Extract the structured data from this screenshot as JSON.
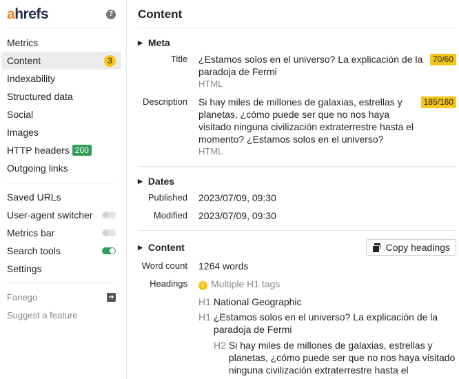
{
  "sidebar": {
    "logo": {
      "a": "a",
      "rest": "hrefs"
    },
    "help": "?",
    "items": [
      {
        "label": "Metrics"
      },
      {
        "label": "Content",
        "badge": "3"
      },
      {
        "label": "Indexability"
      },
      {
        "label": "Structured data"
      },
      {
        "label": "Social"
      },
      {
        "label": "Images"
      },
      {
        "label": "HTTP headers",
        "badge": "200"
      },
      {
        "label": "Outgoing links"
      }
    ],
    "tools": [
      {
        "label": "Saved URLs"
      },
      {
        "label": "User-agent switcher",
        "toggle": false
      },
      {
        "label": "Metrics bar",
        "toggle": false
      },
      {
        "label": "Search tools",
        "toggle": true
      },
      {
        "label": "Settings"
      }
    ],
    "user": "Fanego",
    "suggest": "Suggest a feature"
  },
  "main": {
    "title": "Content",
    "meta": {
      "heading": "Meta",
      "title_label": "Title",
      "title_value": "¿Estamos solos en el universo? La explicación de la paradoja de Fermi",
      "title_type": "HTML",
      "title_count": "70/60",
      "desc_label": "Description",
      "desc_value": "Si hay miles de millones de galaxias, estrellas y planetas, ¿cómo puede ser que no nos haya visitado ninguna civilización extraterrestre hasta el momento? ¿Estamos solos en el universo?",
      "desc_type": "HTML",
      "desc_count": "185/160"
    },
    "dates": {
      "heading": "Dates",
      "published_label": "Published",
      "published": "2023/07/09, 09:30",
      "modified_label": "Modified",
      "modified": "2023/07/09, 09:30"
    },
    "content": {
      "heading": "Content",
      "copy_button": "Copy headings",
      "wc_label": "Word count",
      "wc": "1264 words",
      "headings_label": "Headings",
      "warning": "Multiple H1 tags",
      "headings": [
        {
          "tag": "H1",
          "text": "National Geographic"
        },
        {
          "tag": "H1",
          "text": "¿Estamos solos en el universo? La explicación de la paradoja de Fermi"
        },
        {
          "tag": "H2",
          "text": "Si hay miles de millones de galaxias, estrellas y planetas, ¿cómo puede ser que no nos haya visitado ninguna civilización extraterrestre hasta el"
        }
      ]
    }
  }
}
